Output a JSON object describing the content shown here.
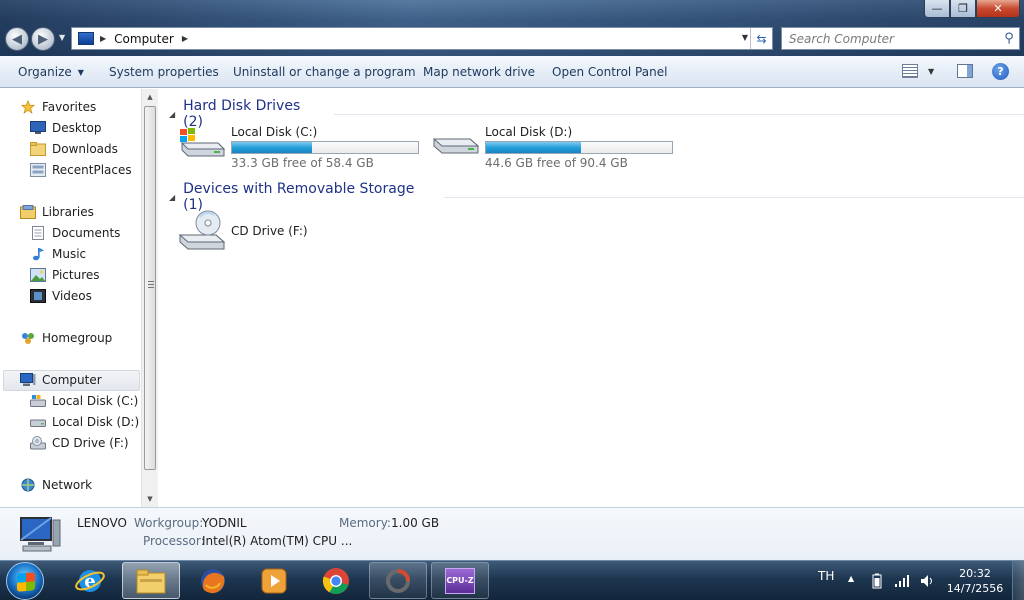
{
  "window": {
    "minimize_glyph": "—",
    "maximize_glyph": "❐",
    "close_glyph": "✕"
  },
  "address": {
    "crumb": "Computer",
    "search_placeholder": "Search Computer"
  },
  "toolbar": {
    "organize": "Organize",
    "system_properties": "System properties",
    "uninstall": "Uninstall or change a program",
    "map_drive": "Map network drive",
    "control_panel": "Open Control Panel"
  },
  "nav": {
    "favorites": "Favorites",
    "desktop": "Desktop",
    "downloads": "Downloads",
    "recent": "RecentPlaces",
    "libraries": "Libraries",
    "documents": "Documents",
    "music": "Music",
    "pictures": "Pictures",
    "videos": "Videos",
    "homegroup": "Homegroup",
    "computer": "Computer",
    "local_c": "Local Disk (C:)",
    "local_d": "Local Disk (D:)",
    "cd": "CD Drive (F:)",
    "network": "Network"
  },
  "main": {
    "hdd_header": "Hard Disk Drives (2)",
    "removable_header": "Devices with Removable Storage (1)",
    "drives": [
      {
        "name": "Local Disk (C:)",
        "free_text": "33.3 GB free of 58.4 GB",
        "used_fraction": 0.43
      },
      {
        "name": "Local Disk (D:)",
        "free_text": "44.6 GB free of 90.4 GB",
        "used_fraction": 0.51
      }
    ],
    "cd_name": "CD Drive (F:)"
  },
  "details": {
    "name": "LENOVO",
    "workgroup_label": "Workgroup:",
    "workgroup_value": "YODNIL",
    "memory_label": "Memory:",
    "memory_value": "1.00 GB",
    "processor_label": "Processor:",
    "processor_value": "Intel(R) Atom(TM) CPU ..."
  },
  "taskbar": {
    "language": "TH",
    "time": "20:32",
    "date": "14/7/2556",
    "cpuz_label": "CPU-Z"
  },
  "colors": {
    "drive_bar_fill": "#26a0da",
    "group_header": "#1e3287"
  }
}
